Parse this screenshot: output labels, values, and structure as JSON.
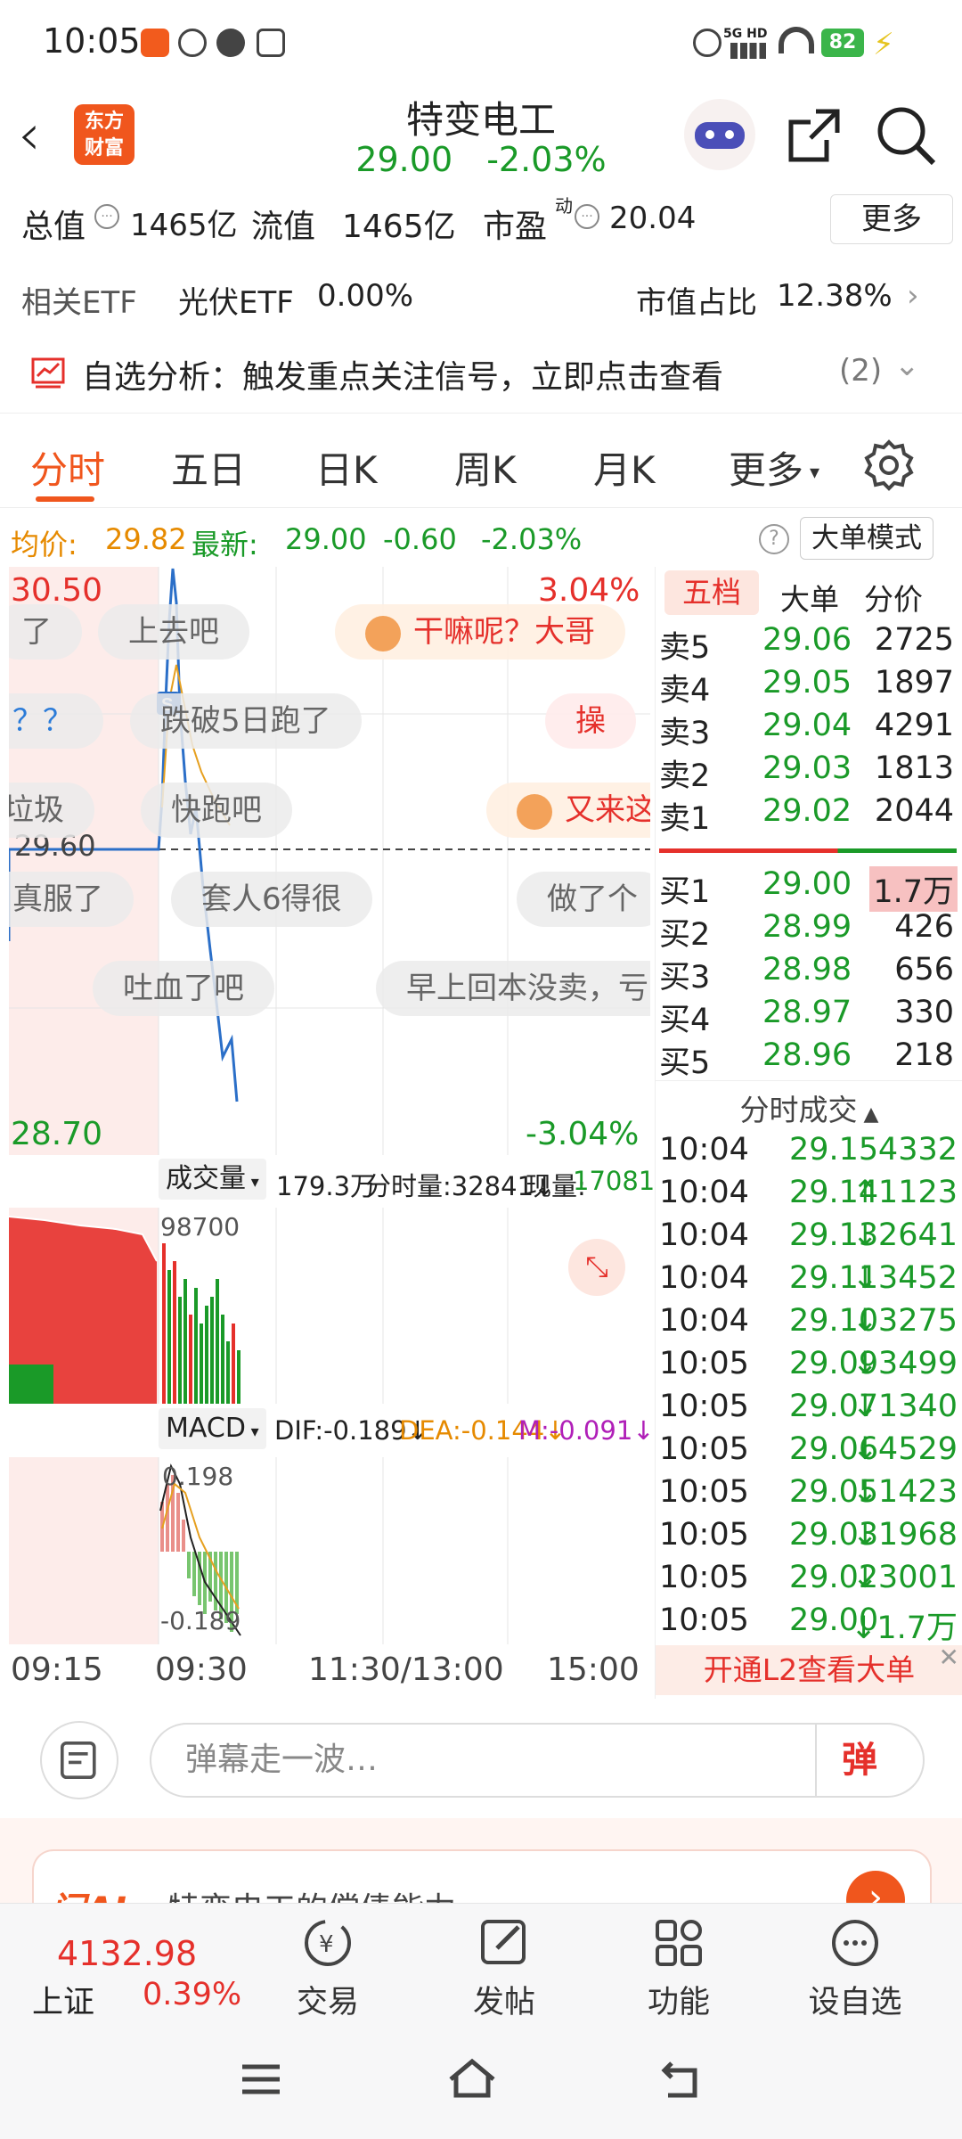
{
  "status": {
    "time": "10:05",
    "battery": "82",
    "network": "5G HD"
  },
  "header": {
    "logo": "东方财富",
    "stock_name": "特变电工",
    "price": "29.00",
    "change_pct": "-2.03%"
  },
  "stats": {
    "total_value_label": "总值",
    "total_value": "1465亿",
    "float_label": "流值",
    "float_value": "1465亿",
    "pe_label": "市盈",
    "pe_sup": "动",
    "pe_value": "20.04",
    "more": "更多"
  },
  "etf": {
    "label": "相关ETF",
    "name": "光伏ETF",
    "pct": "0.00%",
    "weight_label": "市值占比",
    "weight": "12.38%"
  },
  "alert": {
    "text": "自选分析：触发重点关注信号，立即点击查看",
    "count": "(2)"
  },
  "tabs": [
    "分时",
    "五日",
    "日K",
    "周K",
    "月K",
    "更多"
  ],
  "infobar": {
    "avg_label": "均价:",
    "avg": "29.82",
    "latest_label": "最新:",
    "latest": "29.00",
    "chg": "-0.60",
    "pct": "-2.03%",
    "mode": "大单模式"
  },
  "chart": {
    "high": "30.50",
    "high_pct": "3.04%",
    "low": "28.70",
    "low_pct": "-3.04%",
    "prev_close": "29.60"
  },
  "danmaku": [
    "了",
    "上去吧",
    "干嘛呢？大哥",
    "？？",
    "跌破5日跑了",
    "操",
    "垃圾",
    "快跑吧",
    "又来这",
    "真服了",
    "套人6得很",
    "做了个",
    "吐血了吧",
    "早上回本没卖，亏"
  ],
  "volume": {
    "label": "成交量",
    "total": "179.3万",
    "tick_vol": "分时量:32841↓",
    "current_label": "现量:",
    "current": "17081",
    "max": "98700"
  },
  "macd": {
    "label": "MACD",
    "dif": "DIF:-0.189↓",
    "dea": "DEA:-0.144↓",
    "m": "M:-0.091↓",
    "top": "0.198",
    "bottom": "-0.189"
  },
  "time_axis": [
    "09:15",
    "09:30",
    "11:30/13:00",
    "15:00"
  ],
  "orderbook": {
    "tabs": [
      "五档",
      "大单",
      "分价"
    ],
    "asks": [
      {
        "label": "卖5",
        "price": "29.06",
        "vol": "2725"
      },
      {
        "label": "卖4",
        "price": "29.05",
        "vol": "1897"
      },
      {
        "label": "卖3",
        "price": "29.04",
        "vol": "4291"
      },
      {
        "label": "卖2",
        "price": "29.03",
        "vol": "1813"
      },
      {
        "label": "卖1",
        "price": "29.02",
        "vol": "2044"
      }
    ],
    "bids": [
      {
        "label": "买1",
        "price": "29.00",
        "vol": "1.7万"
      },
      {
        "label": "买2",
        "price": "28.99",
        "vol": "426"
      },
      {
        "label": "买3",
        "price": "28.98",
        "vol": "656"
      },
      {
        "label": "买4",
        "price": "28.97",
        "vol": "330"
      },
      {
        "label": "买5",
        "price": "28.96",
        "vol": "218"
      }
    ],
    "trades_title": "分时成交",
    "trades": [
      {
        "t": "10:04",
        "p": "29.15",
        "v": "4332"
      },
      {
        "t": "10:04",
        "p": "29.14",
        "v": "↑1123"
      },
      {
        "t": "10:04",
        "p": "29.13",
        "v": "↓2641"
      },
      {
        "t": "10:04",
        "p": "29.11",
        "v": "↓3452"
      },
      {
        "t": "10:04",
        "p": "29.10",
        "v": "↓3275"
      },
      {
        "t": "10:05",
        "p": "29.09",
        "v": "↓3499"
      },
      {
        "t": "10:05",
        "p": "29.07",
        "v": "↓1340"
      },
      {
        "t": "10:05",
        "p": "29.06",
        "v": "↓4529"
      },
      {
        "t": "10:05",
        "p": "29.05",
        "v": "↓1423"
      },
      {
        "t": "10:05",
        "p": "29.03",
        "v": "↓1968"
      },
      {
        "t": "10:05",
        "p": "29.02",
        "v": "↓3001"
      },
      {
        "t": "10:05",
        "p": "29.00",
        "v": "↓1.7万"
      }
    ],
    "l2_banner": "开通L2查看大单"
  },
  "danmu_input": {
    "placeholder": "弹幕走一波…",
    "send": "弹"
  },
  "ai_card": {
    "text": "特变电工的偿债能力"
  },
  "bottom_nav": {
    "index_value": "4132.98",
    "index_name": "上证",
    "index_pct": "0.39%",
    "items": [
      "交易",
      "发帖",
      "功能",
      "设自选"
    ]
  },
  "colors": {
    "up": "#e5302b",
    "down": "#1a9a28",
    "accent": "#f0561d"
  }
}
